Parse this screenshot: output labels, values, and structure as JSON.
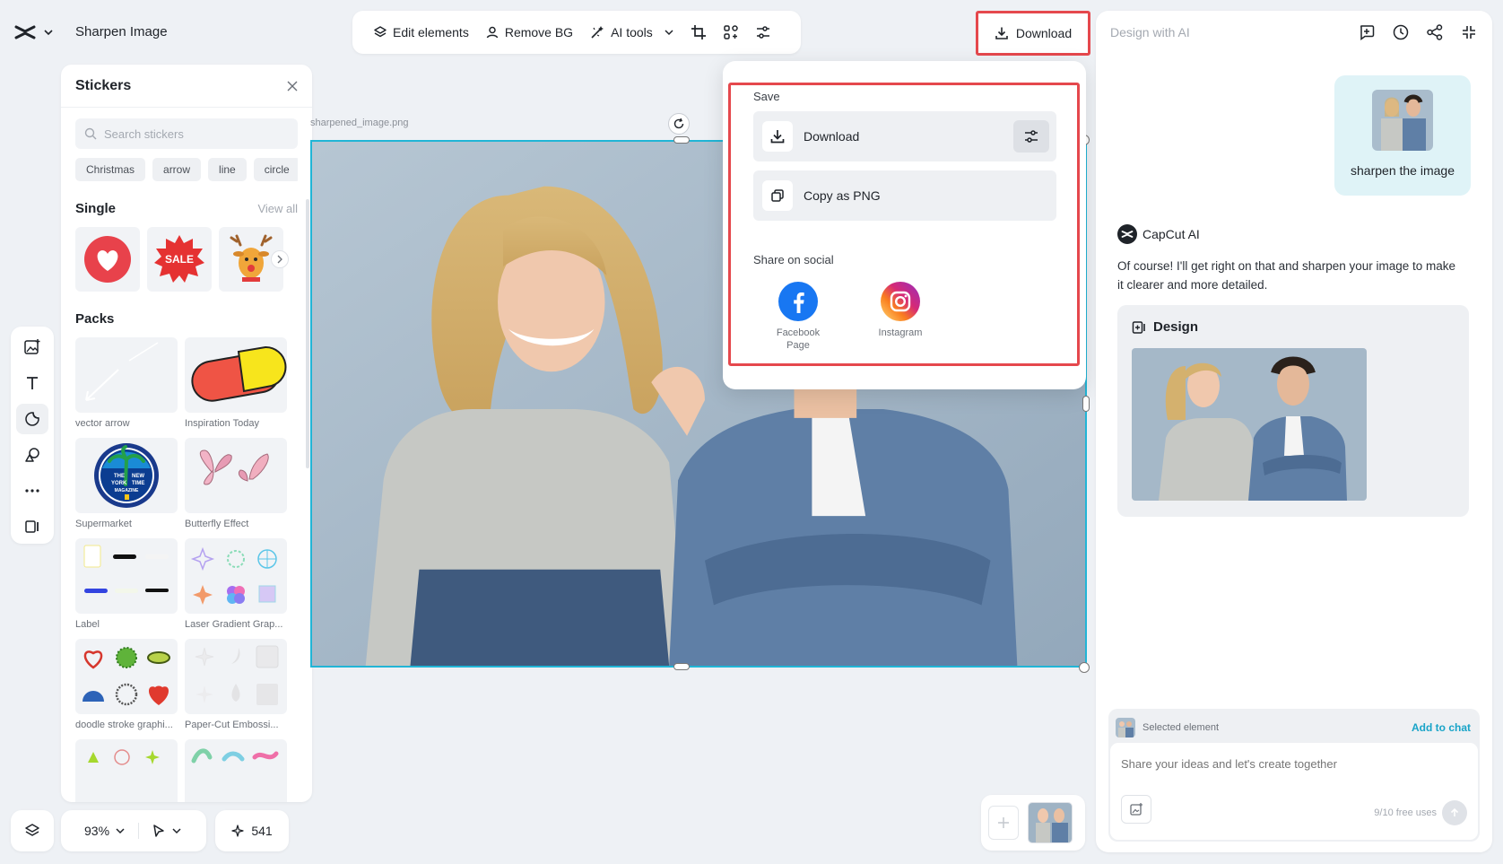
{
  "app": {
    "title": "Sharpen Image"
  },
  "toolbar": {
    "edit_elements": "Edit elements",
    "remove_bg": "Remove BG",
    "ai_tools": "AI tools"
  },
  "download_button": "Download",
  "stickers": {
    "title": "Stickers",
    "search_placeholder": "Search stickers",
    "chips": [
      "Christmas",
      "arrow",
      "line",
      "circle"
    ],
    "single_title": "Single",
    "view_all": "View all",
    "single_items": [
      "heart-sticker",
      "sale-sticker",
      "reindeer-sticker"
    ],
    "sale_text": "SALE",
    "packs_title": "Packs",
    "packs": [
      {
        "name": "vector arrow"
      },
      {
        "name": "Inspiration Today"
      },
      {
        "name": "Supermarket"
      },
      {
        "name": "Butterfly Effect"
      },
      {
        "name": "Label"
      },
      {
        "name": "Laser Gradient Grap..."
      },
      {
        "name": "doodle stroke graphi..."
      },
      {
        "name": "Paper-Cut Embossi..."
      }
    ],
    "supermarket_badge": [
      "THE",
      "NEW",
      "YORK",
      "TIME",
      "MAGAZINE"
    ]
  },
  "canvas": {
    "file_name": "sharpened_image.png"
  },
  "zoom": {
    "level": "93%"
  },
  "credits": {
    "count": "541"
  },
  "download_menu": {
    "save_label": "Save",
    "download_label": "Download",
    "copy_label": "Copy as PNG",
    "share_label": "Share on social",
    "socials": [
      {
        "name_line1": "Facebook",
        "name_line2": "Page"
      },
      {
        "name_line1": "Instagram",
        "name_line2": ""
      }
    ]
  },
  "ai_panel": {
    "title": "Design with AI",
    "user_message": "sharpen the image",
    "assistant_name": "CapCut AI",
    "assistant_message": "Of course! I'll get right on that and sharpen your image to make it clearer and more detailed.",
    "design_label": "Design",
    "selected_element": "Selected element",
    "add_to_chat": "Add to chat",
    "input_placeholder": "Share your ideas and let's create together",
    "free_uses": "9/10 free uses"
  },
  "colors": {
    "accent": "#21b5d6",
    "highlight": "#e5484d",
    "link": "#19a4c8"
  }
}
